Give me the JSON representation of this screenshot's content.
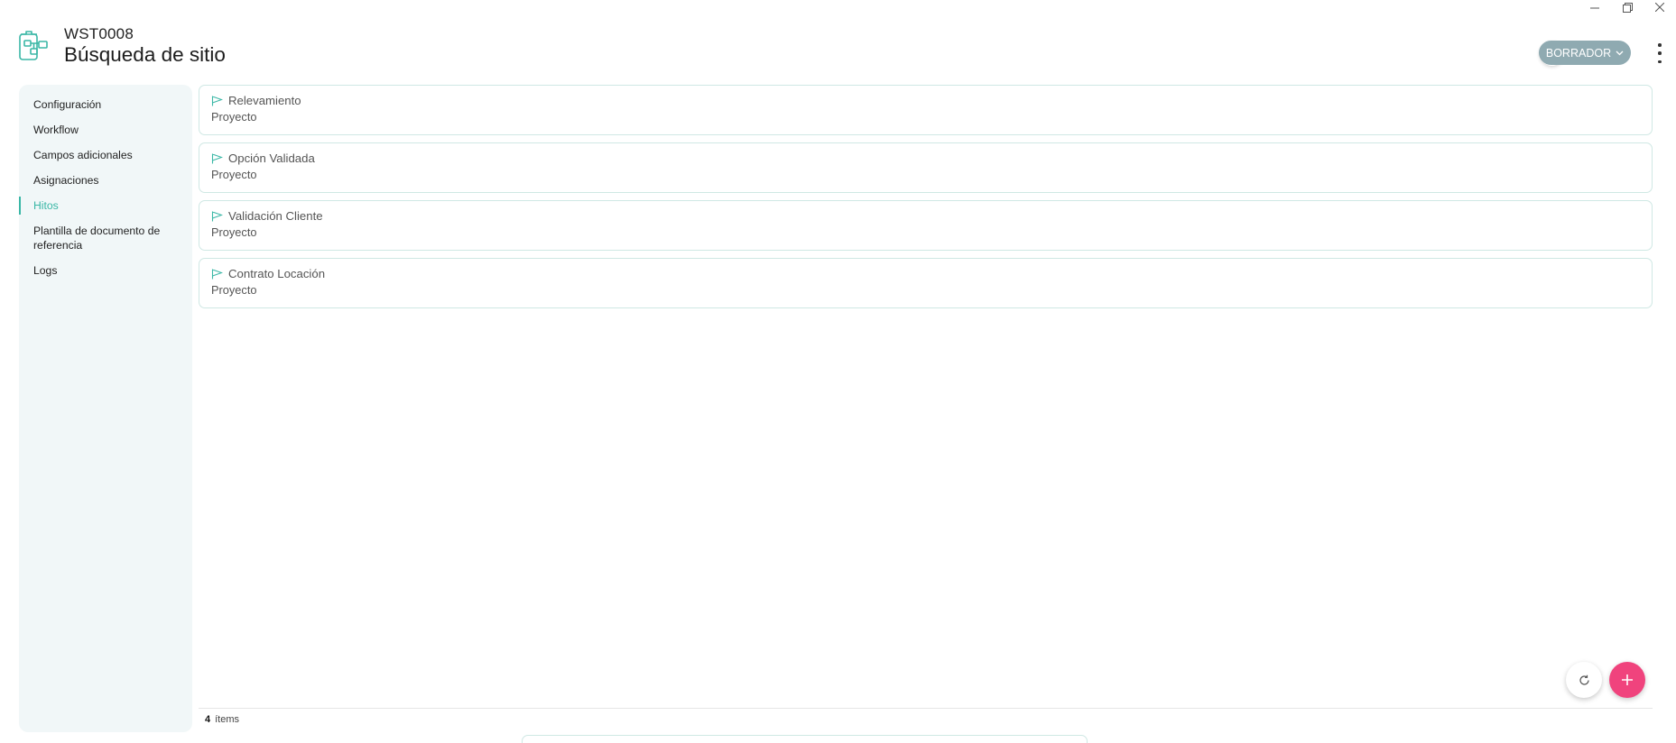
{
  "window_controls": {
    "minimize_icon": "minimize-icon",
    "restore_icon": "restore-icon",
    "close_icon": "close-icon"
  },
  "header": {
    "icon": "workflow-icon",
    "code": "WST0008",
    "title": "Búsqueda de sitio",
    "history_icon": "clock-icon",
    "status_label": "BORRADOR",
    "status_icon": "chevron-down-icon",
    "more_icon": "more-vertical-icon"
  },
  "sidebar": {
    "items": [
      {
        "label": "Configuración",
        "active": false
      },
      {
        "label": "Workflow",
        "active": false
      },
      {
        "label": "Campos adicionales",
        "active": false
      },
      {
        "label": "Asignaciones",
        "active": false
      },
      {
        "label": "Hitos",
        "active": true
      },
      {
        "label": "Plantilla de documento de referencia",
        "active": false
      },
      {
        "label": "Logs",
        "active": false
      }
    ]
  },
  "milestones": [
    {
      "name": "Relevamiento",
      "type": "Proyecto",
      "icon": "flag-icon"
    },
    {
      "name": "Opción Validada",
      "type": "Proyecto",
      "icon": "flag-icon"
    },
    {
      "name": "Validación Cliente",
      "type": "Proyecto",
      "icon": "flag-icon"
    },
    {
      "name": "Contrato Locación",
      "type": "Proyecto",
      "icon": "flag-icon"
    }
  ],
  "footer": {
    "count": "4",
    "count_label": "ítems"
  },
  "fabs": {
    "refresh_icon": "refresh-icon",
    "add_icon": "plus-icon"
  },
  "colors": {
    "accent": "#3ab7a6",
    "status_bg": "#8faab1",
    "add_fab": "#f0437d",
    "sidebar_bg": "#f1f7f8",
    "card_border": "#cfe8e4"
  }
}
